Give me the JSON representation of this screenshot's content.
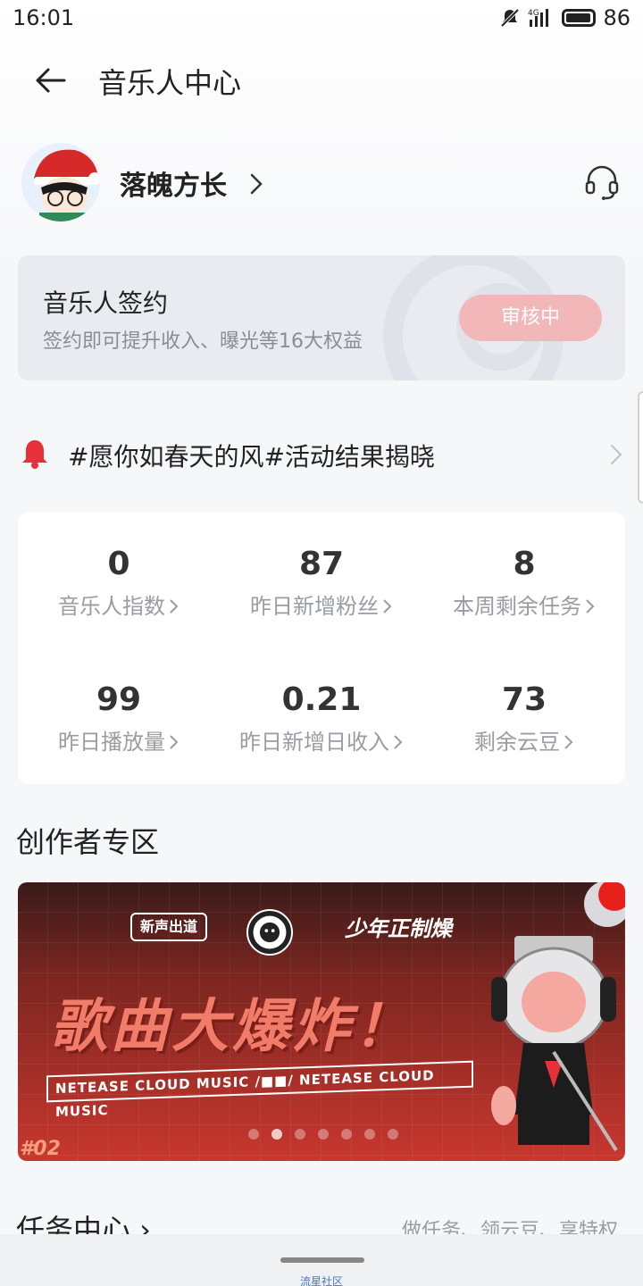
{
  "status_bar": {
    "time": "16:01",
    "network": "4G",
    "battery": "86"
  },
  "header": {
    "title": "音乐人中心"
  },
  "profile": {
    "name": "落魄方长"
  },
  "sign_card": {
    "title": "音乐人签约",
    "subtitle": "签约即可提升收入、曝光等16大权益",
    "button": "审核中"
  },
  "notice": {
    "text": "#愿你如春天的风#活动结果揭晓"
  },
  "stats": [
    {
      "value": "0",
      "label": "音乐人指数"
    },
    {
      "value": "87",
      "label": "昨日新增粉丝"
    },
    {
      "value": "8",
      "label": "本周剩余任务"
    },
    {
      "value": "99",
      "label": "昨日播放量"
    },
    {
      "value": "0.21",
      "label": "昨日新增日收入"
    },
    {
      "value": "73",
      "label": "剩余云豆"
    }
  ],
  "creator": {
    "title": "创作者专区",
    "banner": {
      "logo_left": "新声出道",
      "logo_right": "少年正制燥",
      "headline": "歌曲大爆炸！",
      "strip": "NETEASE CLOUD MUSIC /■■/ NETEASE CLOUD MUSIC",
      "number": "#02",
      "slide_count": 7,
      "active_slide": 2
    }
  },
  "task": {
    "title": "任务中心 ›",
    "subtitle": "做任务、领云豆、享特权"
  },
  "bottom": {
    "label": "流星社区"
  },
  "colors": {
    "accent": "#f1b7b9",
    "bell": "#e8303a"
  }
}
